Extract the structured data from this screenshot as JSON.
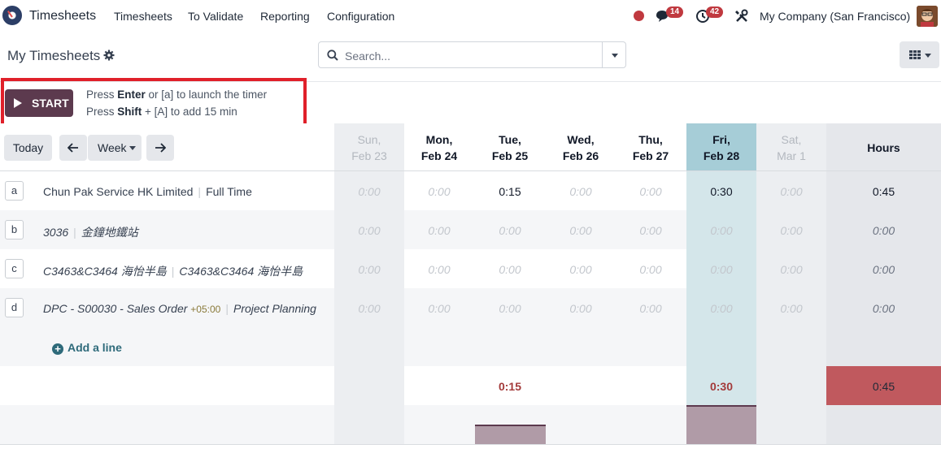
{
  "navbar": {
    "app_name": "Timesheets",
    "menu": [
      "Timesheets",
      "To Validate",
      "Reporting",
      "Configuration"
    ],
    "messages_count": "14",
    "activities_count": "42",
    "company": "My Company (San Francisco)"
  },
  "control": {
    "title": "My Timesheets",
    "search_placeholder": "Search..."
  },
  "timer": {
    "start_label": "START",
    "hint1_pre": "Press ",
    "hint1_key": "Enter",
    "hint1_post": " or [a] to launch the timer",
    "hint2_pre": "Press ",
    "hint2_key": "Shift",
    "hint2_post": " + [A] to add 15 min"
  },
  "grid": {
    "today_label": "Today",
    "prev_icon": "arrow-left-icon",
    "next_icon": "arrow-right-icon",
    "range_label": "Week",
    "days": [
      {
        "d1": "Sun,",
        "d2": "Feb 23"
      },
      {
        "d1": "Mon,",
        "d2": "Feb 24"
      },
      {
        "d1": "Tue,",
        "d2": "Feb 25"
      },
      {
        "d1": "Wed,",
        "d2": "Feb 26"
      },
      {
        "d1": "Thu,",
        "d2": "Feb 27"
      },
      {
        "d1": "Fri,",
        "d2": "Feb 28"
      },
      {
        "d1": "Sat,",
        "d2": "Mar 1"
      }
    ],
    "hours_label": "Hours",
    "rows": [
      {
        "key": "a",
        "project": "Chun Pak Service HK Limited",
        "tz": "",
        "task": "Full Time",
        "cells": [
          "0:00",
          "0:00",
          "0:15",
          "0:00",
          "0:00",
          "0:30",
          "0:00"
        ],
        "total": "0:45"
      },
      {
        "key": "b",
        "project": "3036",
        "tz": "",
        "task": "金鐘地鐵站",
        "cells": [
          "0:00",
          "0:00",
          "0:00",
          "0:00",
          "0:00",
          "0:00",
          "0:00"
        ],
        "total": "0:00"
      },
      {
        "key": "c",
        "project": "C3463&C3464 海怡半島",
        "tz": "",
        "task": "C3463&C3464 海怡半島",
        "cells": [
          "0:00",
          "0:00",
          "0:00",
          "0:00",
          "0:00",
          "0:00",
          "0:00"
        ],
        "total": "0:00"
      },
      {
        "key": "d",
        "project": "DPC - S00030 - Sales Order",
        "tz": "+05:00",
        "task": "Project Planning",
        "cells": [
          "0:00",
          "0:00",
          "0:00",
          "0:00",
          "0:00",
          "0:00",
          "0:00"
        ],
        "total": "0:00"
      }
    ],
    "add_line_label": "Add a line",
    "footer_totals": [
      "",
      "",
      "0:15",
      "",
      "",
      "0:30",
      ""
    ],
    "grand_total": "0:45",
    "daily_hours_bars": [
      0,
      0,
      0.25,
      0,
      0,
      0.5,
      0
    ]
  },
  "colors": {
    "accent": "#5c3a4e",
    "today_column": "#d4e6ea",
    "today_header": "#a6cdd7",
    "overtime": "#c0595e"
  }
}
